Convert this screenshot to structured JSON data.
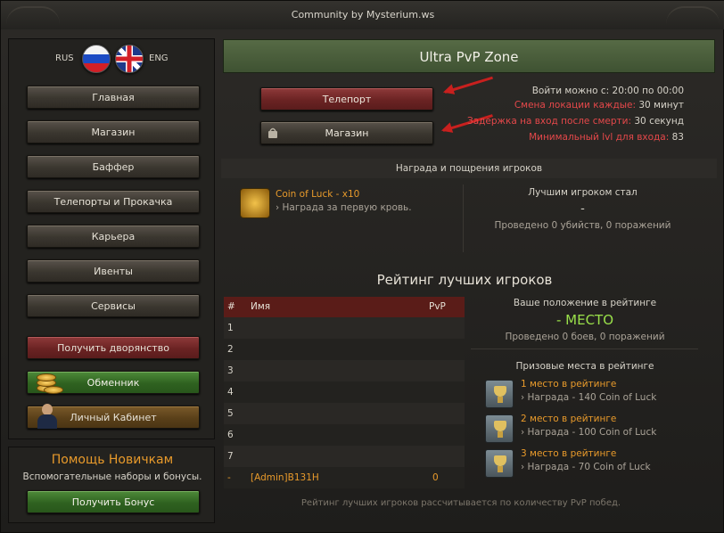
{
  "window": {
    "title": "Community by Mysterium.ws"
  },
  "lang": {
    "rus": "RUS",
    "eng": "ENG"
  },
  "sidebar": {
    "items": [
      {
        "label": "Главная"
      },
      {
        "label": "Магазин"
      },
      {
        "label": "Баффер"
      },
      {
        "label": "Телепорты и Прокачка"
      },
      {
        "label": "Карьера"
      },
      {
        "label": "Ивенты"
      },
      {
        "label": "Сервисы"
      }
    ],
    "noble": "Получить дворянство",
    "exchanger": "Обменник",
    "cabinet": "Личный Кабинет"
  },
  "help": {
    "title": "Помощь Новичкам",
    "subtitle": "Вспомогательные наборы и бонусы.",
    "button": "Получить Бонус"
  },
  "zone": {
    "title": "Ultra PvP Zone",
    "teleport": "Телепорт",
    "shop": "Магазин",
    "info": {
      "entry_label": "Войти можно с:",
      "entry_value": "20:00 по 00:00",
      "loc_label": "Смена локации каждые:",
      "loc_value": "30 минут",
      "delay_label": "Задержка на вход после смерти:",
      "delay_value": "30 секунд",
      "lvl_label": "Минимальный lvl для входа:",
      "lvl_value": "83"
    }
  },
  "rewards": {
    "header": "Награда и пощрения игроков",
    "item_title": "Coin of Luck - x10",
    "item_desc": "› Награда за первую кровь.",
    "best_title": "Лучшим игроком стал",
    "best_name": "-",
    "best_stat": "Проведено 0 убийств, 0 поражений"
  },
  "rating": {
    "title": "Рейтинг лучших игроков",
    "columns": {
      "num": "#",
      "name": "Имя",
      "pvp": "PvP"
    },
    "rows": [
      {
        "num": "1",
        "name": "",
        "pvp": ""
      },
      {
        "num": "2",
        "name": "",
        "pvp": ""
      },
      {
        "num": "3",
        "name": "",
        "pvp": ""
      },
      {
        "num": "4",
        "name": "",
        "pvp": ""
      },
      {
        "num": "5",
        "name": "",
        "pvp": ""
      },
      {
        "num": "6",
        "name": "",
        "pvp": ""
      },
      {
        "num": "7",
        "name": "",
        "pvp": ""
      },
      {
        "num": "-",
        "name": "[Admin]B131H",
        "pvp": "0"
      }
    ],
    "your_pos_title": "Ваше положение в рейтинге",
    "your_pos": "- МЕСТО",
    "your_stat": "Проведено 0 боев, 0 поражений",
    "prize_title": "Призовые места в рейтинге",
    "prizes": [
      {
        "title": "1 место в рейтинге",
        "desc": "› Награда - 140 Coin of Luck"
      },
      {
        "title": "2 место в рейтинге",
        "desc": "› Награда - 100 Coin of Luck"
      },
      {
        "title": "3 место в рейтинге",
        "desc": "› Награда - 70 Coin of Luck"
      }
    ],
    "footer": "Рейтинг лучших игроков рассчитывается по количеству PvP побед."
  }
}
